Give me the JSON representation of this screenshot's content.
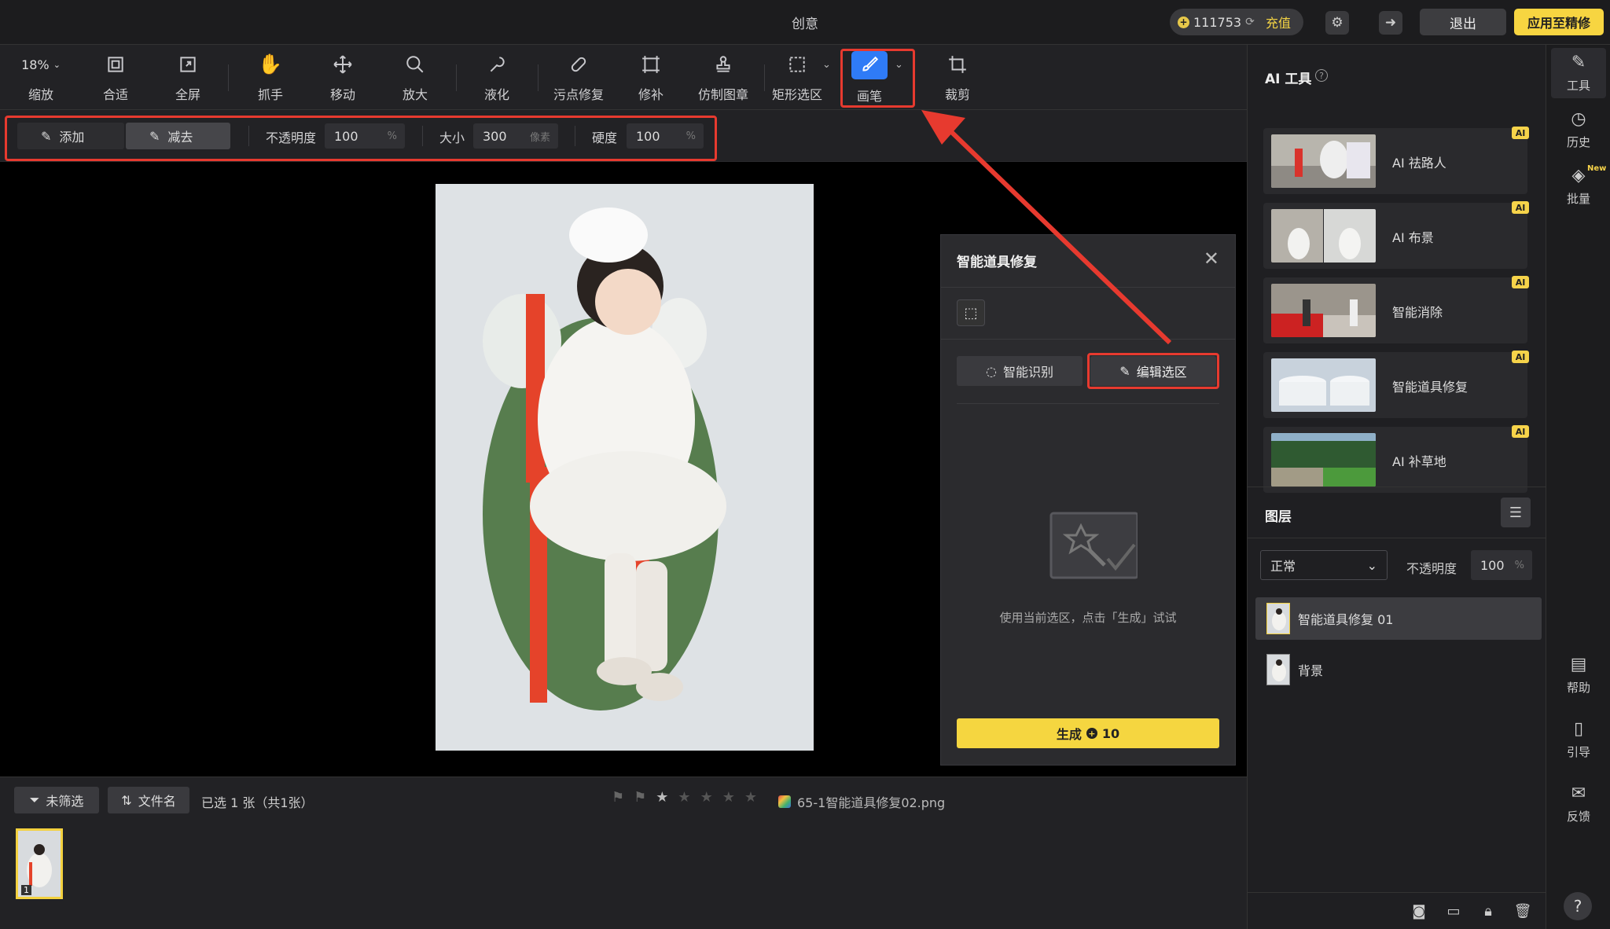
{
  "title": "创意",
  "top": {
    "coins": "111753",
    "recharge": "充值",
    "exit": "退出",
    "apply": "应用至精修"
  },
  "toolbar": {
    "zoom": "18%",
    "fit": "合适",
    "fullscreen": "全屏",
    "hand": "抓手",
    "move": "移动",
    "magnify": "放大",
    "liquify": "液化",
    "spot_heal": "污点修复",
    "patch": "修补",
    "clone": "仿制图章",
    "rect_select": "矩形选区",
    "brush": "画笔",
    "crop": "裁剪",
    "zoom_label": "缩放"
  },
  "options": {
    "add": "添加",
    "subtract": "减去",
    "opacity_label": "不透明度",
    "opacity": "100",
    "opacity_unit": "%",
    "size_label": "大小",
    "size": "300",
    "size_unit": "像素",
    "hardness_label": "硬度",
    "hardness": "100",
    "hardness_unit": "%"
  },
  "dialog": {
    "title": "智能道具修复",
    "recognize": "智能识别",
    "edit_selection": "编辑选区",
    "hint": "使用当前选区，点击「生成」试试",
    "generate": "生成",
    "generate_cost": "10"
  },
  "ai_tools": {
    "title": "AI 工具",
    "items": [
      {
        "name": "AI 祛路人",
        "badge": "AI"
      },
      {
        "name": "AI 布景",
        "badge": "AI"
      },
      {
        "name": "智能消除",
        "badge": "AI"
      },
      {
        "name": "智能道具修复",
        "badge": "AI"
      },
      {
        "name": "AI 补草地",
        "badge": "AI"
      }
    ]
  },
  "layers": {
    "title": "图层",
    "blend": "正常",
    "opacity_label": "不透明度",
    "opacity": "100",
    "opacity_unit": "%",
    "items": [
      {
        "name": "智能道具修复 01"
      },
      {
        "name": "背景"
      }
    ]
  },
  "rail": {
    "tools": "工具",
    "history": "历史",
    "batch": "批量",
    "new": "New",
    "help": "帮助",
    "guide": "引导",
    "feedback": "反馈"
  },
  "bottom": {
    "filter": "未筛选",
    "sort": "文件名",
    "selected": "已选 1 张（共1张）",
    "filename": "65-1智能道具修复02.png",
    "thumb_index": "1",
    "rating": 0,
    "rating_max": 5
  },
  "colors": {
    "accent_yellow": "#f7d541",
    "brush_blue": "#2f7bf6",
    "highlight_red": "#e73a2f"
  }
}
